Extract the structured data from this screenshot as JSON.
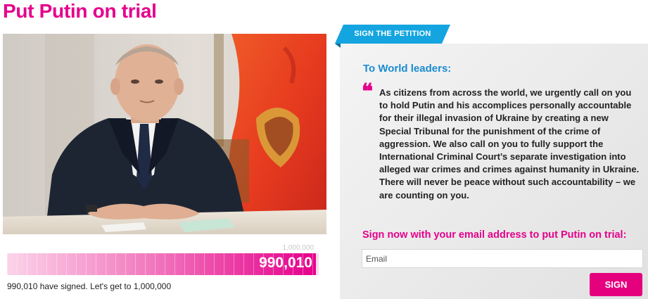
{
  "page": {
    "title": "Put Putin on trial"
  },
  "photo": {
    "alt": "Vladimir Putin seated at desk in front of Russian flag"
  },
  "progress": {
    "goal_label": "1,000,000",
    "count_label": "990,010",
    "fraction": 0.99001,
    "summary": "990,010 have signed. Let's get to 1,000,000"
  },
  "petition": {
    "tab_label": "SIGN THE PETITION",
    "addressee": "To World leaders:",
    "quote_icon": "quote-icon",
    "body": "As citizens from across the world, we urgently call on you to hold Putin and his accomplices personally accountable for their illegal invasion of Ukraine by creating a new Special Tribunal for the punishment of the crime of aggression. We also call on you to fully support the International Criminal Court’s separate investigation into alleged war crimes and crimes against humanity in Ukraine. There will never be peace without such accountability – we are counting on you."
  },
  "form": {
    "prompt": "Sign now with your email address to put Putin on trial:",
    "email_placeholder": "Email",
    "email_value": "",
    "submit_label": "SIGN"
  },
  "colors": {
    "brand_pink": "#e5008c",
    "tab_blue": "#14a5e0",
    "heading_blue": "#1a8bd0"
  }
}
